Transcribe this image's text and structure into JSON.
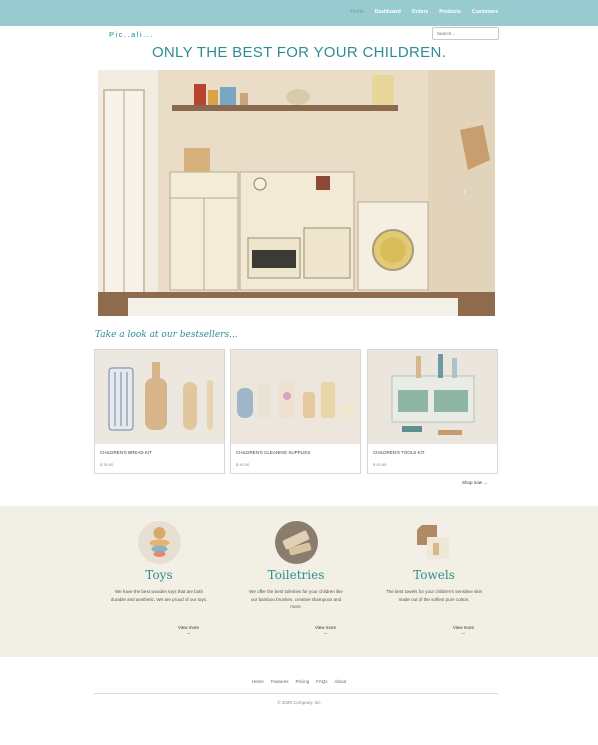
{
  "nav": {
    "items": [
      {
        "label": "Home",
        "active": true
      },
      {
        "label": "Dashboard"
      },
      {
        "label": "Orders"
      },
      {
        "label": "Products"
      },
      {
        "label": "Customers"
      }
    ]
  },
  "brand": {
    "logo_text": "Pic..ali..."
  },
  "search": {
    "placeholder": "Search..."
  },
  "hero": {
    "headline": "ONLY THE BEST FOR YOUR CHILDREN.",
    "arrow": "›"
  },
  "bestsellers": {
    "title": "Take a look at our bestsellers...",
    "cards": [
      {
        "name": "CHILDREN'S BREAD KIT",
        "price": "$ 35.90"
      },
      {
        "name": "CHILDREN'S CLEANING SUPPLIES",
        "price": "$ 40.90"
      },
      {
        "name": "CHILDREN'S TOOLS KIT",
        "price": "$ 43.90"
      }
    ],
    "shop_now": "Shop now →"
  },
  "categories": [
    {
      "title": "Toys",
      "desc": "We have the best wooden toys that are both durable and aesthetic. We are proud of our toys.",
      "more": "View more",
      "arrow": "→"
    },
    {
      "title": "Toiletries",
      "desc": "We offer the best toiletries for your children like our bamboo brushes, creative shampoos and more.",
      "more": "View more",
      "arrow": "→"
    },
    {
      "title": "Towels",
      "desc": "The best towels for your children's sensitive skin made out of the softest pure cotton.",
      "more": "View more",
      "arrow": "→"
    }
  ],
  "footer": {
    "links": [
      "Home",
      "Features",
      "Pricing",
      "FAQs",
      "About"
    ],
    "copyright": "© 2025 Company, Inc"
  },
  "colors": {
    "topbar": "#97cbd0",
    "accent": "#2d8d93",
    "band": "#f2efe5"
  }
}
